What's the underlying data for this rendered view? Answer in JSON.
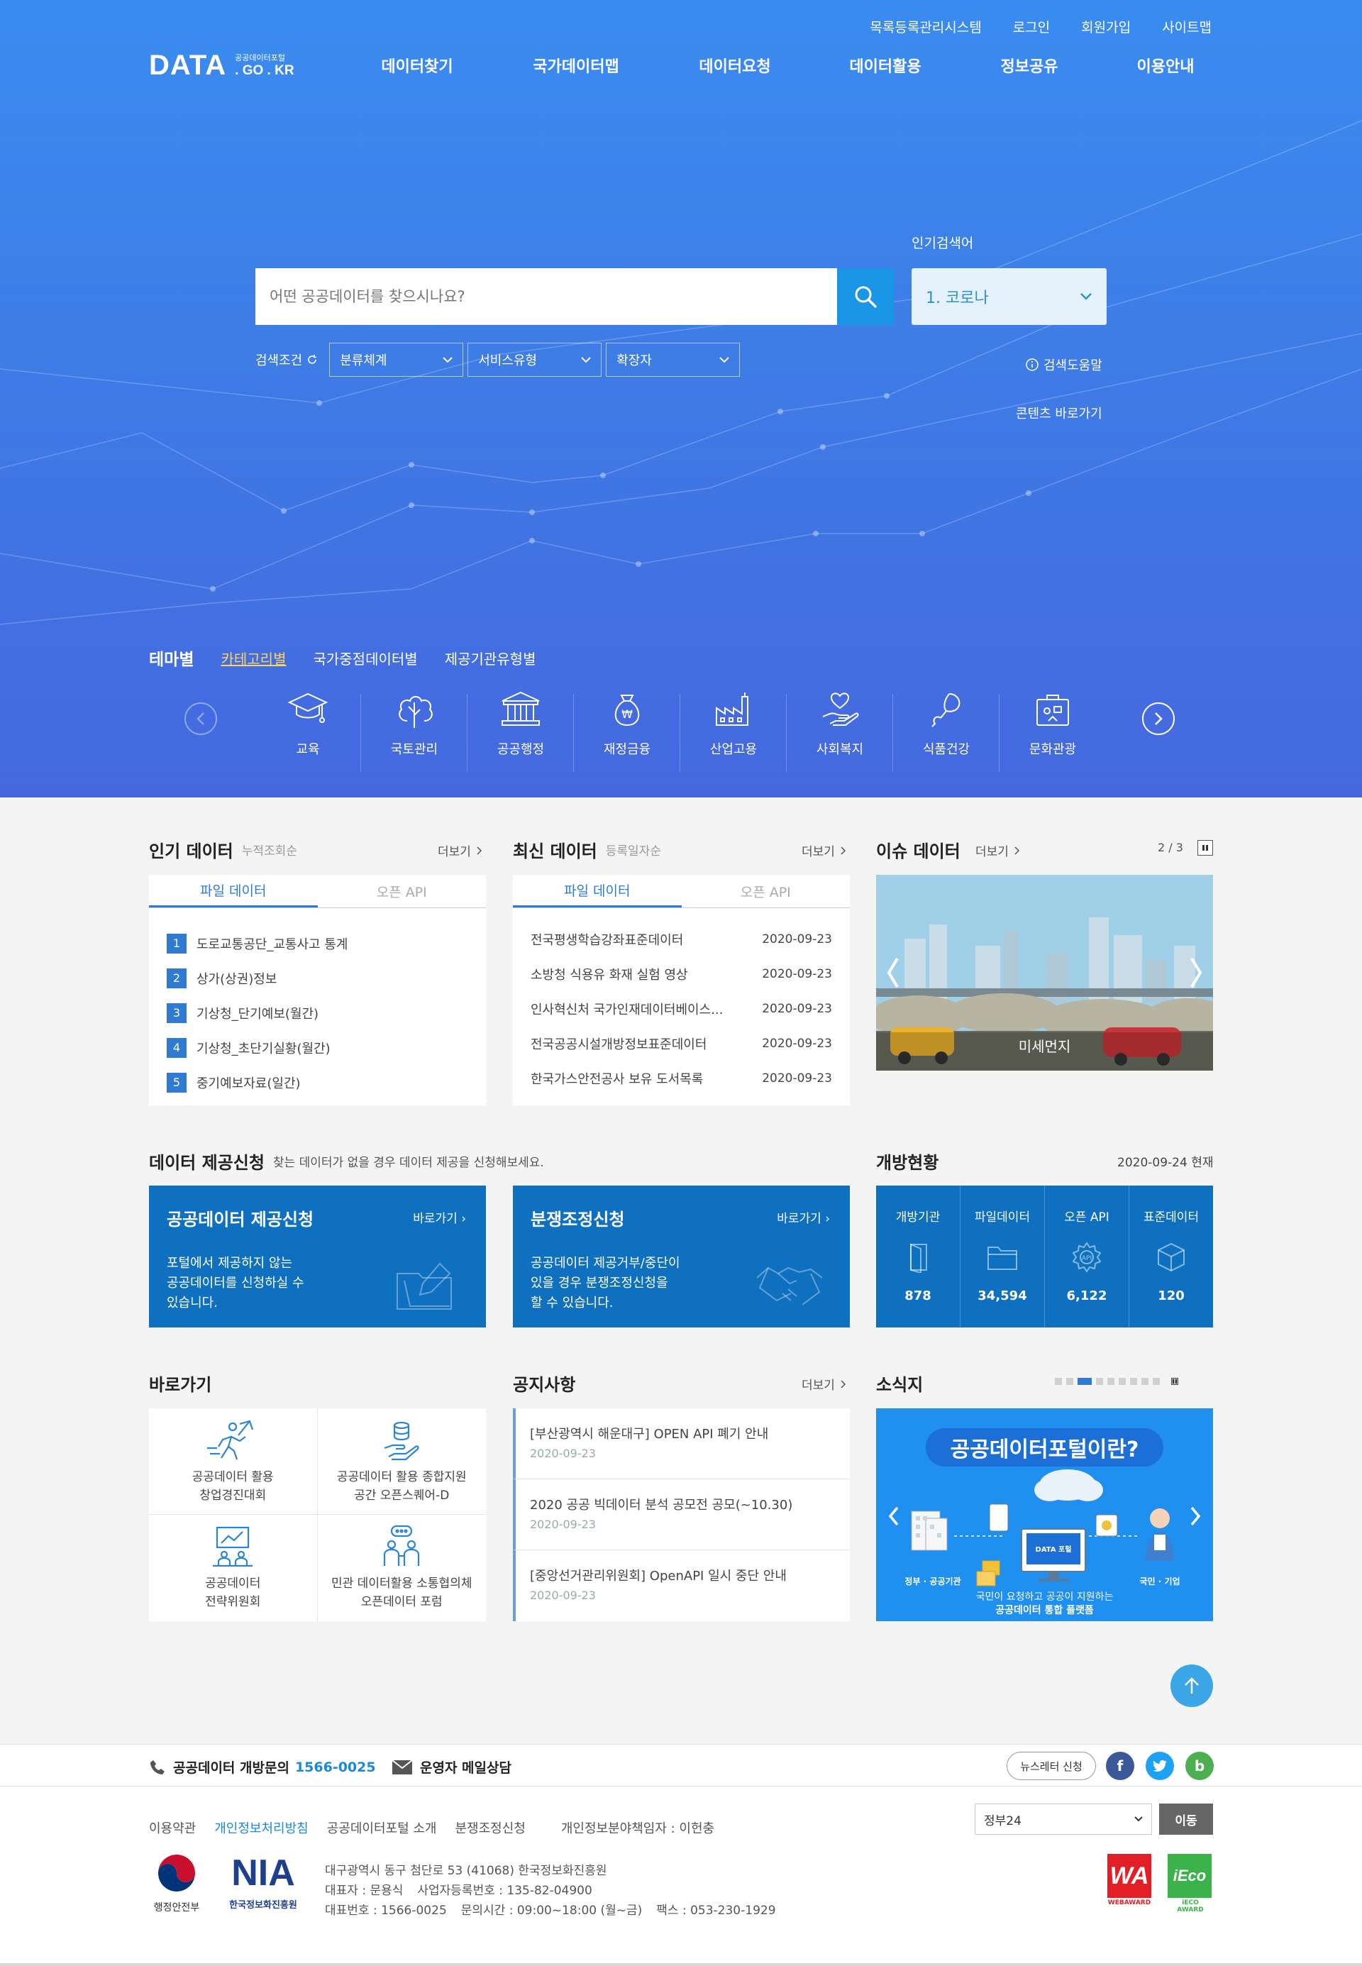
{
  "util_links": [
    "목록등록관리시스템",
    "로그인",
    "회원가입",
    "사이트맵"
  ],
  "logo": {
    "big": "DATA",
    "small_top": "공공데이터포털",
    "small_bottom": ". GO . KR"
  },
  "gnb": [
    "데이터찾기",
    "국가데이터맵",
    "데이터요청",
    "데이터활용",
    "정보공유",
    "이용안내"
  ],
  "search": {
    "placeholder": "어떤 공공데이터를 찾으시나요?"
  },
  "popular_search": {
    "label": "인기검색어",
    "selected": "1. 코로나"
  },
  "conditions": {
    "label": "검색조건",
    "selects": [
      "분류체계",
      "서비스유형",
      "확장자"
    ]
  },
  "help_link": "검색도움말",
  "contents_link": "콘텐츠 바로가기",
  "theme_tabs": [
    "테마별",
    "카테고리별",
    "국가중점데이터별",
    "제공기관유형별"
  ],
  "categories": [
    "교육",
    "국토관리",
    "공공행정",
    "재정금융",
    "산업고용",
    "사회복지",
    "식품건강",
    "문화관광"
  ],
  "popular_data": {
    "title": "인기 데이터",
    "sub": "누적조회순",
    "more": "더보기",
    "tabs": [
      "파일 데이터",
      "오픈 API"
    ],
    "items": [
      "도로교통공단_교통사고 통계",
      "상가(상권)정보",
      "기상청_단기예보(월간)",
      "기상청_초단기실황(월간)",
      "중기예보자료(일간)"
    ]
  },
  "latest_data": {
    "title": "최신 데이터",
    "sub": "등록일자순",
    "more": "더보기",
    "tabs": [
      "파일 데이터",
      "오픈 API"
    ],
    "items": [
      {
        "name": "전국평생학습강좌표준데이터",
        "date": "2020-09-23"
      },
      {
        "name": "소방청 식용유 화재 실험 영상",
        "date": "2020-09-23"
      },
      {
        "name": "인사혁신처 국가인재데이터베이스...",
        "date": "2020-09-23"
      },
      {
        "name": "전국공공시설개방정보표준데이터",
        "date": "2020-09-23"
      },
      {
        "name": "한국가스안전공사 보유 도서목록",
        "date": "2020-09-23"
      }
    ]
  },
  "issue_data": {
    "title": "이슈 데이터",
    "more": "더보기",
    "page": "2 / 3",
    "caption": "미세먼지"
  },
  "request": {
    "title": "데이터 제공신청",
    "sub": "찾는 데이터가 없을 경우 데이터 제공을 신청해보세요.",
    "cards": [
      {
        "title": "공공데이터 제공신청",
        "go": "바로가기",
        "desc": [
          "포털에서 제공하지 않는",
          "공공데이터를 신청하실 수",
          "있습니다."
        ]
      },
      {
        "title": "분쟁조정신청",
        "go": "바로가기",
        "desc": [
          "공공데이터 제공거부/중단이",
          "있을 경우 분쟁조정신청을",
          "할 수 있습니다."
        ]
      }
    ]
  },
  "open_status": {
    "title": "개방현황",
    "date": "2020-09-24 현재",
    "items": [
      {
        "label": "개방기관",
        "value": "878"
      },
      {
        "label": "파일데이터",
        "value": "34,594"
      },
      {
        "label": "오픈 API",
        "value": "6,122"
      },
      {
        "label": "표준데이터",
        "value": "120"
      }
    ]
  },
  "quick_links": {
    "title": "바로가기",
    "items": [
      [
        "공공데이터 활용",
        "창업경진대회"
      ],
      [
        "공공데이터 활용 종합지원",
        "공간 오픈스퀘어-D"
      ],
      [
        "공공데이터",
        "전략위원회"
      ],
      [
        "민관 데이터활용 소통협의체",
        "오픈데이터 포럼"
      ]
    ]
  },
  "notices": {
    "title": "공지사항",
    "more": "더보기",
    "items": [
      {
        "title": "[부산광역시 해운대구] OPEN API 폐기 안내",
        "date": "2020-09-23"
      },
      {
        "title": "2020 공공 빅데이터 분석 공모전 공모(~10.30)",
        "date": "2020-09-23"
      },
      {
        "title": "[중앙선거관리위원회] OpenAPI 일시 중단 안내",
        "date": "2020-09-23"
      }
    ]
  },
  "news": {
    "title": "소식지",
    "banner_title": "공공데이터포털이란?",
    "banner_left": "정부 · 공공기관",
    "banner_right": "국민 · 기업",
    "banner_center": "DATA 포털",
    "banner_bottom1": "국민이 요청하고 공공이 지원하는",
    "banner_bottom2": "공공데이터 통합 플랫폼"
  },
  "footer": {
    "phone_label": "공공데이터 개방문의",
    "phone": "1566-0025",
    "mail_label": "운영자 메일상담",
    "newsletter": "뉴스레터 신청",
    "links": [
      "이용약관",
      "개인정보처리방침",
      "공공데이터포털 소개",
      "분쟁조정신청"
    ],
    "privacy_manager": "개인정보분야책임자 : 이헌충",
    "select": "정부24",
    "go": "이동",
    "mois": "행정안전부",
    "nia": "NIA",
    "nia_sub": "한국정보화진흥원",
    "address": "대구광역시 동구 첨단로 53 (41068) 한국정보화진흥원",
    "ceo": "대표자 : 문용식",
    "biz_no": "사업자등록번호 : 135-82-04900",
    "tel": "대표번호 : 1566-0025",
    "hours": "문의시간 : 09:00~18:00 (월~금)",
    "fax": "팩스 : 053-230-1929",
    "award1": "WEBAWARD",
    "award2": "iECO AWARD"
  }
}
